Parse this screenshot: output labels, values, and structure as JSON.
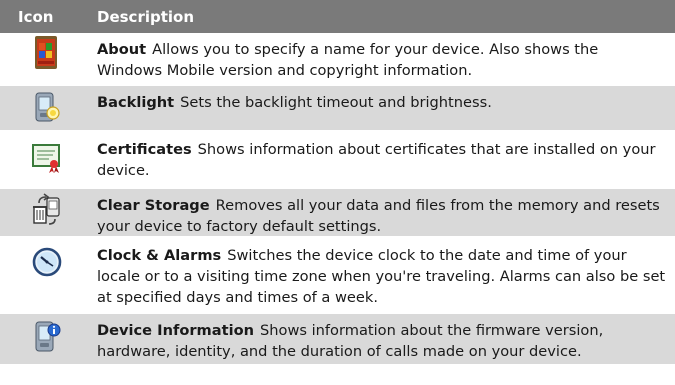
{
  "header": {
    "icon_col": "Icon",
    "desc_col": "Description"
  },
  "rows": [
    {
      "title": "About",
      "text": "Allows you to specify a name for your device. Also shows the Windows Mobile version and copyright information.",
      "icon": "about-icon"
    },
    {
      "title": "Backlight",
      "text": "Sets the backlight timeout and brightness.",
      "icon": "backlight-icon"
    },
    {
      "title": "Certificates",
      "text": "Shows information about certificates that are installed on your device.",
      "icon": "certificate-icon"
    },
    {
      "title": "Clear Storage",
      "text": "Removes all your data and files from the memory and resets your device to factory default settings.",
      "icon": "clear-storage-icon"
    },
    {
      "title": "Clock & Alarms",
      "text": "Switches the device clock to the date and time of your locale or to a visiting time zone when you're traveling. Alarms can also be set at specified days and times of a week.",
      "icon": "clock-icon"
    },
    {
      "title": "Device Information",
      "text": "Shows information about the firmware version, hardware, identity, and the duration of calls made on your device.",
      "icon": "device-information-icon"
    }
  ]
}
